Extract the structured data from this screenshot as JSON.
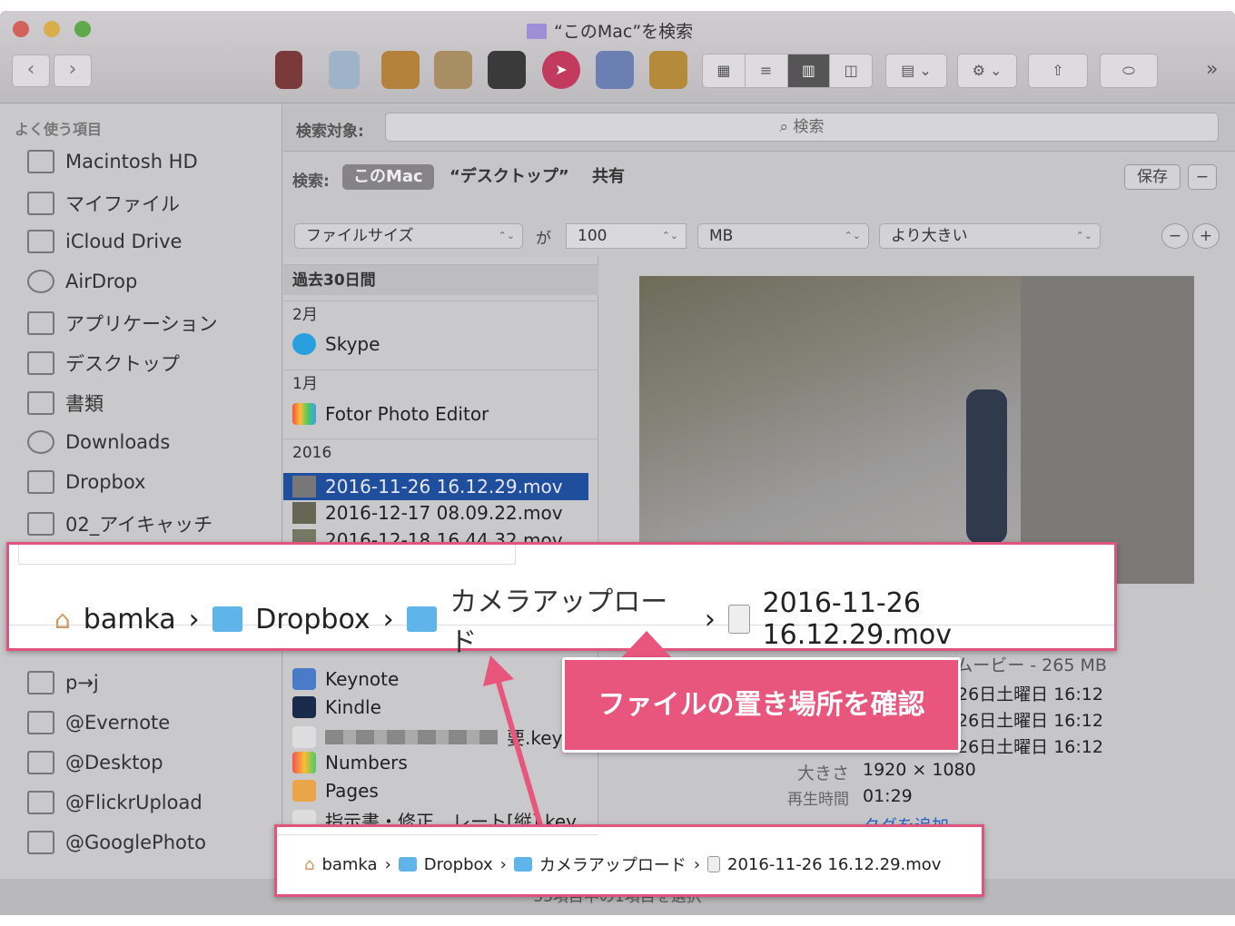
{
  "window": {
    "title": "“このMac”を検索"
  },
  "toolbar": {
    "back": "‹",
    "forward": "›",
    "view_buttons": [
      "icon-view",
      "list-view",
      "column-view",
      "coverflow-view"
    ],
    "active_view": "column-view",
    "more": "»"
  },
  "sidebar": {
    "header": "よく使う項目",
    "items": [
      {
        "label": "Macintosh HD",
        "icon": "hard-drive-icon"
      },
      {
        "label": "マイファイル",
        "icon": "all-files-icon"
      },
      {
        "label": "iCloud Drive",
        "icon": "cloud-icon"
      },
      {
        "label": "AirDrop",
        "icon": "airdrop-icon"
      },
      {
        "label": "アプリケーション",
        "icon": "applications-icon"
      },
      {
        "label": "デスクトップ",
        "icon": "desktop-icon"
      },
      {
        "label": "書類",
        "icon": "documents-icon"
      },
      {
        "label": "Downloads",
        "icon": "downloads-icon"
      },
      {
        "label": "Dropbox",
        "icon": "dropbox-icon"
      },
      {
        "label": "02_アイキャッチ",
        "icon": "folder-icon"
      },
      {
        "label": "p→j",
        "icon": "folder-icon"
      },
      {
        "label": "@Evernote",
        "icon": "folder-icon"
      },
      {
        "label": "@Desktop",
        "icon": "folder-icon"
      },
      {
        "label": "@FlickrUpload",
        "icon": "folder-icon"
      },
      {
        "label": "@GooglePhoto",
        "icon": "folder-icon"
      }
    ]
  },
  "search": {
    "scope_label": "検索対象:",
    "placeholder": "検索",
    "search_label": "検索:",
    "scopes": [
      "このMac",
      "“デスクトップ”",
      "共有"
    ],
    "save": "保存",
    "minus": "−",
    "plus": "+"
  },
  "criteria": {
    "attribute": "ファイルサイズ",
    "connector": "が",
    "value": "100",
    "unit": "MB",
    "operator": "より大きい"
  },
  "results": {
    "header": "過去30日間",
    "groups": [
      {
        "label": "2月",
        "items": [
          "Skype"
        ]
      },
      {
        "label": "1月",
        "items": [
          "Fotor Photo Editor"
        ]
      },
      {
        "label": "2016",
        "items": [
          "2016-11-26 16.12.29.mov",
          "2016-12-17 08.09.22.mov",
          "2016-12-18 16.44.32.mov"
        ]
      }
    ],
    "selected": "2016-11-26 16.12.29.mov",
    "more_items": [
      "Keynote",
      "Kindle",
      "要.key",
      "Numbers",
      "Pages",
      "指示書・修正…レート[縦].key"
    ]
  },
  "info": {
    "kind_partial": "QuickTimeムービー - 265 MB",
    "dates": [
      "26日土曜日 16:12",
      "26日土曜日 16:12",
      "26日土曜日 16:12"
    ],
    "size_label": "大きさ",
    "size": "1920 × 1080",
    "duration_label": "再生時間",
    "duration": "01:29",
    "add_tags": "タグを追加..."
  },
  "path": {
    "items": [
      "bamka",
      "Dropbox",
      "カメラアップロード",
      "2016-11-26 16.12.29.mov"
    ],
    "separator": "›"
  },
  "status": "33項目中の1項目を選択",
  "annotation": {
    "callout": "ファイルの置き場所を確認",
    "color": "#e8567e"
  }
}
